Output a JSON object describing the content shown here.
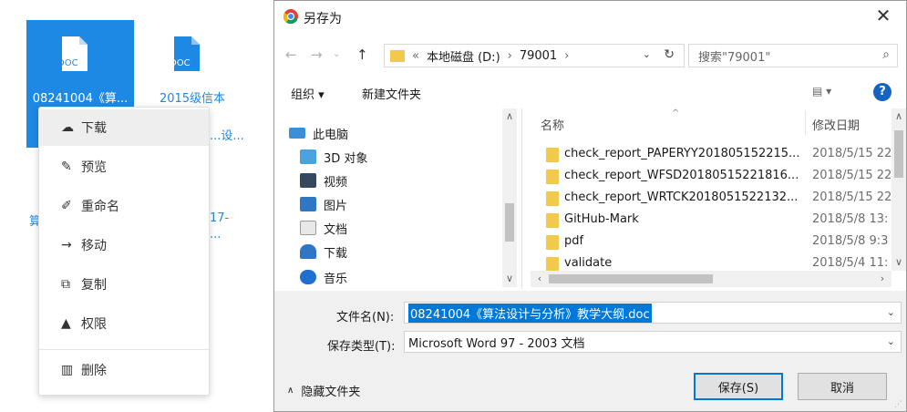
{
  "background": {
    "files": [
      {
        "ext": "DOC",
        "name": "08241004《算...",
        "selected": true
      },
      {
        "ext": "DOC",
        "name": "2015级信本",
        "selected": false
      }
    ],
    "partial_texts": [
      "...设...",
      "算",
      "17-",
      "..."
    ]
  },
  "context_menu": {
    "items": [
      {
        "label": "下载",
        "icon": "cloud-download-icon"
      },
      {
        "label": "预览",
        "icon": "pencil-icon"
      },
      {
        "label": "重命名",
        "icon": "edit-icon"
      },
      {
        "label": "移动",
        "icon": "arrow-right-icon"
      },
      {
        "label": "复制",
        "icon": "copy-icon"
      },
      {
        "label": "权限",
        "icon": "lock-icon"
      },
      {
        "label": "删除",
        "icon": "trash-icon"
      }
    ]
  },
  "dialog": {
    "title": "另存为",
    "address": {
      "prefix": "«",
      "crumbs": [
        "本地磁盘 (D:)",
        "79001"
      ]
    },
    "search_placeholder": "搜索\"79001\"",
    "toolbar": {
      "organize": "组织 ▾",
      "new_folder": "新建文件夹"
    },
    "nav": [
      {
        "label": "此电脑",
        "icon": "computer-icon"
      },
      {
        "label": "3D 对象",
        "icon": "cube-icon"
      },
      {
        "label": "视频",
        "icon": "video-icon"
      },
      {
        "label": "图片",
        "icon": "picture-icon"
      },
      {
        "label": "文档",
        "icon": "document-icon"
      },
      {
        "label": "下载",
        "icon": "download-icon"
      },
      {
        "label": "音乐",
        "icon": "music-icon"
      }
    ],
    "columns": {
      "name": "名称",
      "date": "修改日期"
    },
    "files": [
      {
        "name": "check_report_PAPERYY201805152215...",
        "date": "2018/5/15 22"
      },
      {
        "name": "check_report_WFSD20180515221816...",
        "date": "2018/5/15 22"
      },
      {
        "name": "check_report_WRTCK2018051522132...",
        "date": "2018/5/15 22"
      },
      {
        "name": "GitHub-Mark",
        "date": "2018/5/8 13:"
      },
      {
        "name": "pdf",
        "date": "2018/5/8 9:3"
      },
      {
        "name": "validate",
        "date": "2018/5/4 11:"
      }
    ],
    "filename_label": "文件名(N):",
    "filename_value": "08241004《算法设计与分析》教学大纲.doc",
    "filetype_label": "保存类型(T):",
    "filetype_value": "Microsoft Word 97 - 2003 文档",
    "hide_folders": "隐藏文件夹",
    "save_button": "保存(S)",
    "cancel_button": "取消"
  }
}
